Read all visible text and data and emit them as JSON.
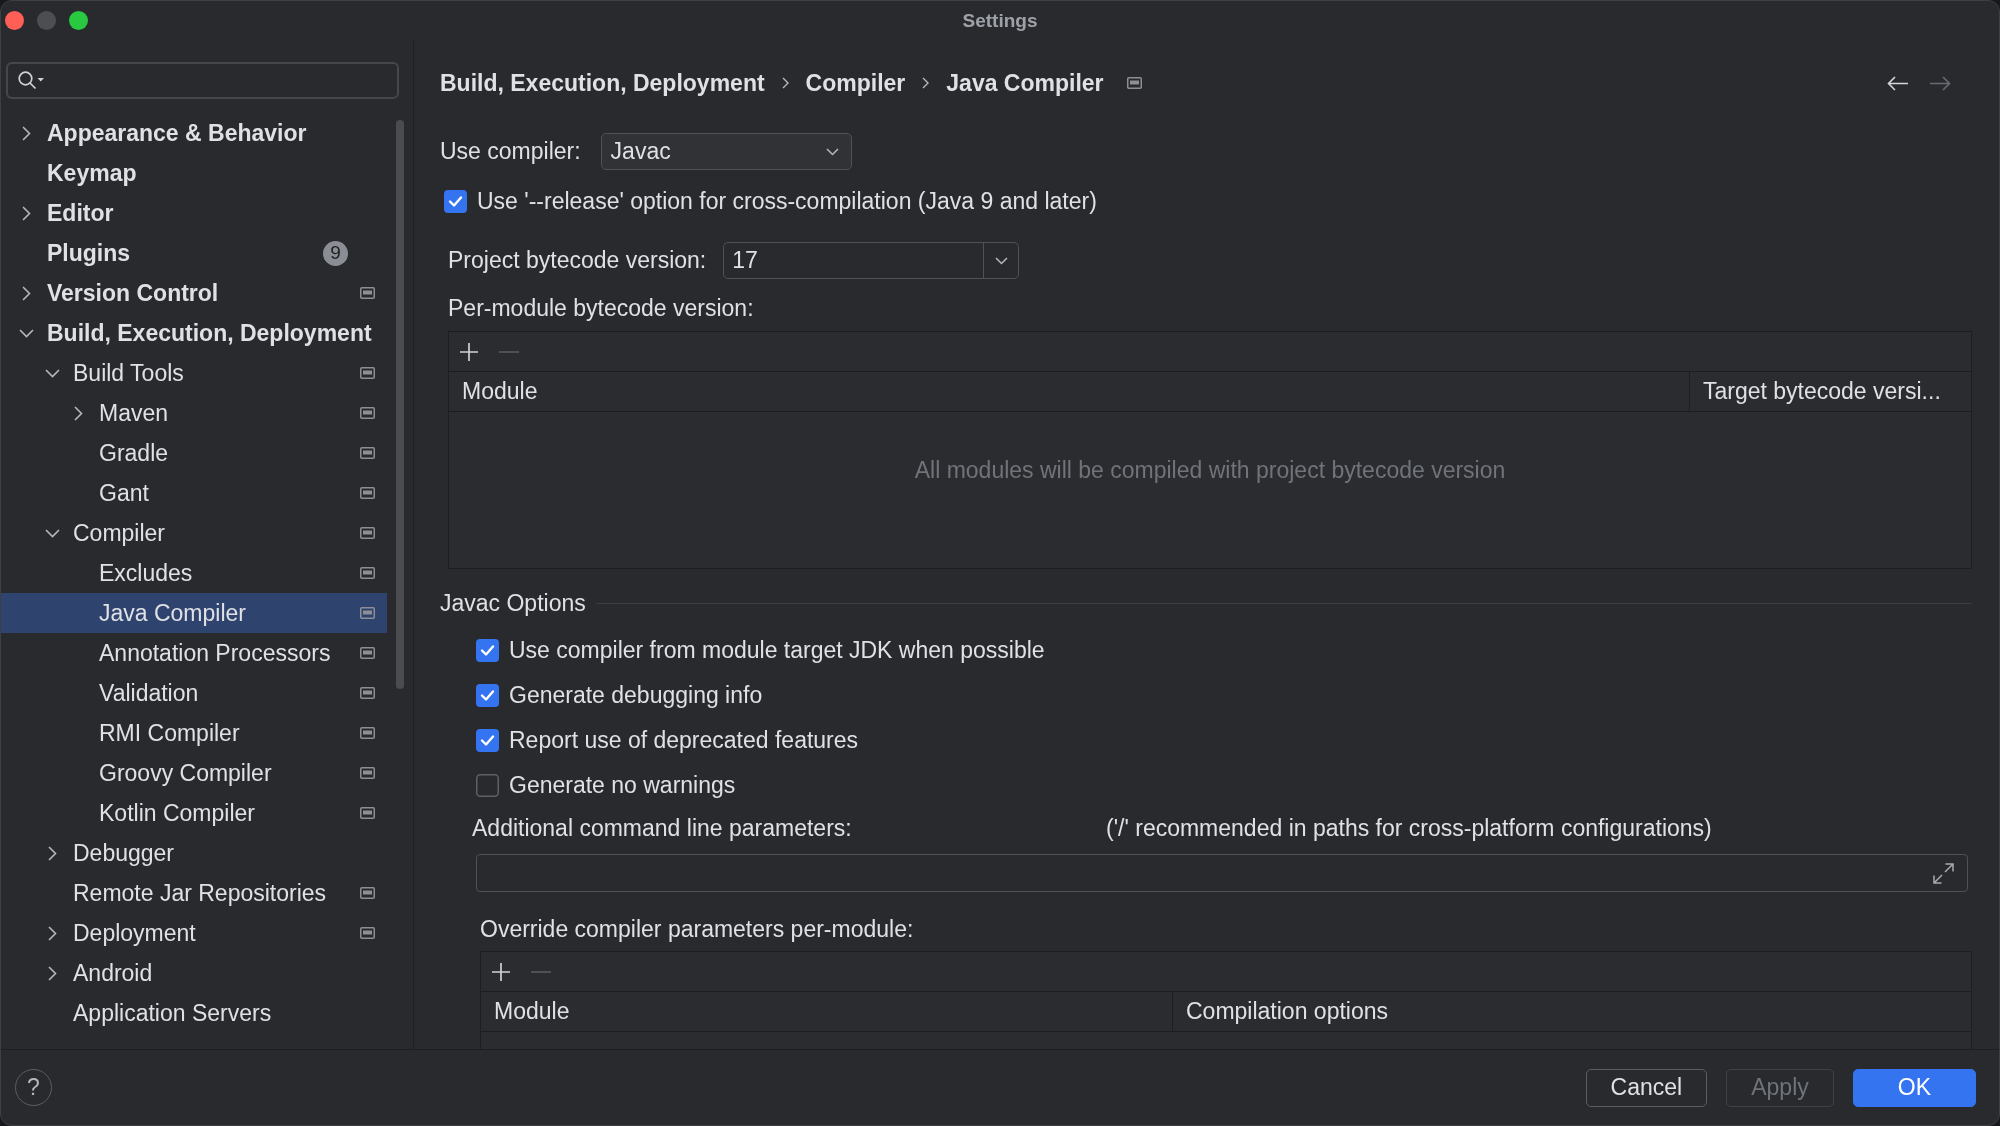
{
  "window": {
    "title": "Settings",
    "controls": [
      {
        "kind": "close",
        "disabled": false
      },
      {
        "kind": "minimize",
        "disabled": true
      },
      {
        "kind": "maximize",
        "disabled": false
      }
    ]
  },
  "sidebar": {
    "items": [
      {
        "label": "Appearance & Behavior",
        "expanded": false,
        "selected": false,
        "project_level": false
      },
      {
        "label": "Keymap",
        "selected": false,
        "project_level": false
      },
      {
        "label": "Editor",
        "expanded": false,
        "selected": false,
        "project_level": false
      },
      {
        "label": "Plugins",
        "selected": false,
        "project_level": false,
        "badge": "9"
      },
      {
        "label": "Version Control",
        "expanded": false,
        "selected": false,
        "project_level": true
      },
      {
        "label": "Build, Execution, Deployment",
        "expanded": true,
        "selected": false,
        "project_level": false,
        "children": [
          {
            "label": "Build Tools",
            "expanded": true,
            "selected": false,
            "project_level": true,
            "children": [
              {
                "label": "Maven",
                "expanded": false,
                "selected": false,
                "project_level": true
              },
              {
                "label": "Gradle",
                "selected": false,
                "project_level": true
              },
              {
                "label": "Gant",
                "selected": false,
                "project_level": true
              }
            ]
          },
          {
            "label": "Compiler",
            "expanded": true,
            "selected": false,
            "project_level": true,
            "children": [
              {
                "label": "Excludes",
                "selected": false,
                "project_level": true
              },
              {
                "label": "Java Compiler",
                "selected": true,
                "project_level": true
              },
              {
                "label": "Annotation Processors",
                "selected": false,
                "project_level": true
              },
              {
                "label": "Validation",
                "selected": false,
                "project_level": true
              },
              {
                "label": "RMI Compiler",
                "selected": false,
                "project_level": true
              },
              {
                "label": "Groovy Compiler",
                "selected": false,
                "project_level": true
              },
              {
                "label": "Kotlin Compiler",
                "selected": false,
                "project_level": true
              }
            ]
          },
          {
            "label": "Debugger",
            "expanded": false,
            "selected": false,
            "project_level": false
          },
          {
            "label": "Remote Jar Repositories",
            "selected": false,
            "project_level": true
          },
          {
            "label": "Deployment",
            "expanded": false,
            "selected": false,
            "project_level": true
          },
          {
            "label": "Android",
            "expanded": false,
            "selected": false,
            "project_level": false
          },
          {
            "label": "Application Servers",
            "selected": false,
            "project_level": false
          }
        ]
      }
    ]
  },
  "breadcrumb": {
    "items": [
      "Build, Execution, Deployment",
      "Compiler",
      "Java Compiler"
    ],
    "project_level": true
  },
  "navigation": [
    {
      "kind": "back",
      "disabled": false
    },
    {
      "kind": "forward",
      "disabled": true
    }
  ],
  "compiler": {
    "label": "Use compiler:",
    "value": "Javac"
  },
  "release_option": {
    "label": "Use '--release' option for cross-compilation (Java 9 and later)",
    "checked": true
  },
  "project_bytecode": {
    "label": "Project bytecode version:",
    "value": "17"
  },
  "per_module": {
    "label": "Per-module bytecode version:",
    "toolbar": [
      {
        "kind": "add",
        "disabled": false
      },
      {
        "kind": "remove",
        "disabled": true
      }
    ],
    "columns": [
      "Module",
      "Target bytecode versi..."
    ],
    "empty_text": "All modules will be compiled with project bytecode version"
  },
  "javac_options": {
    "title": "Javac Options",
    "options": [
      {
        "label": "Use compiler from module target JDK when possible",
        "checked": true
      },
      {
        "label": "Generate debugging info",
        "checked": true
      },
      {
        "label": "Report use of deprecated features",
        "checked": true
      },
      {
        "label": "Generate no warnings",
        "checked": false
      }
    ],
    "additional_parameters": {
      "label": "Additional command line parameters:",
      "hint": "('/' recommended in paths for cross-platform configurations)"
    },
    "override": {
      "label": "Override compiler parameters per-module:",
      "toolbar": [
        {
          "kind": "add",
          "disabled": false
        },
        {
          "kind": "remove",
          "disabled": true
        }
      ],
      "columns": [
        "Module",
        "Compilation options"
      ]
    }
  },
  "footer": {
    "help": "?",
    "buttons": [
      {
        "label": "Cancel",
        "kind": "secondary",
        "disabled": false
      },
      {
        "label": "Apply",
        "kind": "secondary",
        "disabled": true
      },
      {
        "label": "OK",
        "kind": "primary",
        "disabled": false
      }
    ]
  }
}
